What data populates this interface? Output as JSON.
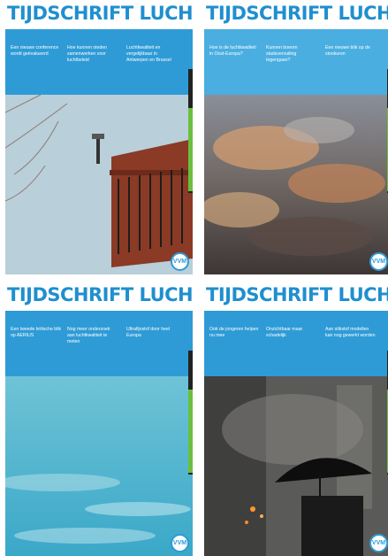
{
  "colors": {
    "brand_blue": "#2e9bd6",
    "light_blue": "#4aaee0",
    "green": "#6bbf3f"
  },
  "covers": [
    {
      "title": "TIJDSCHRIFT LUCHT",
      "subtitle": "",
      "headlines": [
        "Een nieuwe conference wordt geëvalueerd",
        "Hoe kunnen steden samenwerken voor luchtbeleid",
        "Luchtkwaliteit en vergelijkbaar in Antwerpen en Brussel"
      ],
      "logo": "VVM",
      "photo": "balcony-with-weather-station"
    },
    {
      "title": "TIJDSCHRIFT LUCHT",
      "subtitle": "",
      "headlines": [
        "Hoe is de luchtkwaliteit in Oost-Europa?",
        "Kunnen boeren stadsvervuiling tegengaan?",
        "Een nieuwe blik op de stookuren"
      ],
      "logo": "VVM",
      "photo": "sunset-clouds"
    },
    {
      "title": "TIJDSCHRIFT LUCHT",
      "subtitle": "",
      "headlines": [
        "Een tweede kritische blik op AERIUS",
        "Nog meer onderzoek aan luchtkwaliteit te meten",
        "Ultrafijnstof door heel Europa"
      ],
      "logo": "VVM",
      "photo": "blue-sky"
    },
    {
      "title": "TIJDSCHRIFT LUCHT",
      "subtitle": "",
      "headlines": [
        "Ook de jongeren helpen nu mee",
        "Onzichtbaar maar schadelijk",
        "Aan stikstof modellen kan nog gewerkt worden"
      ],
      "logo": "VVM",
      "photo": "umbrella-in-smog"
    }
  ]
}
